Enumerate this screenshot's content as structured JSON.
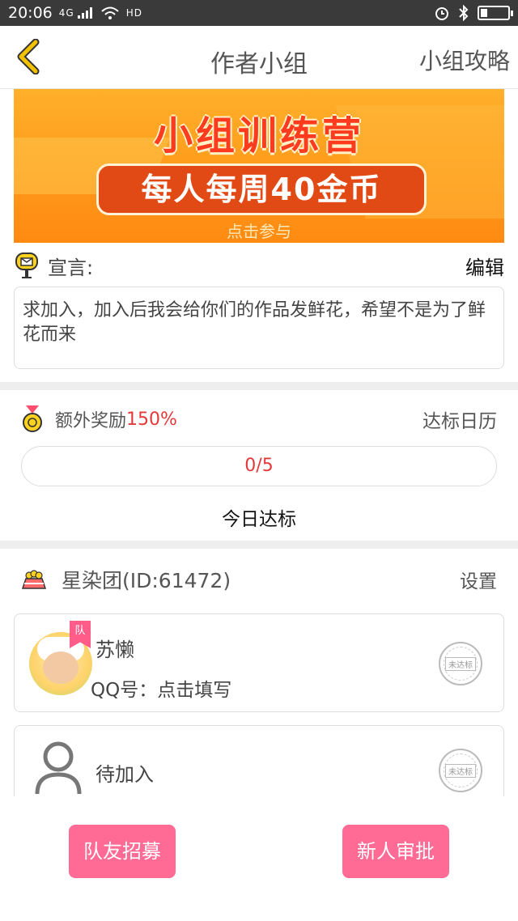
{
  "status_bar": {
    "time": "20:06",
    "signal": "4G",
    "network": "HD"
  },
  "nav": {
    "back_icon": "chevron-left-icon",
    "title": "作者小组",
    "right_link": "小组攻略"
  },
  "banner": {
    "title": "小组训练营",
    "subtitle": "每人每周40金币",
    "cta": "点击参与"
  },
  "manifesto": {
    "label": "宣言:",
    "edit": "编辑",
    "text": "求加入，加入后我会给你们的作品发鲜花，希望不是为了鲜花而来"
  },
  "reward": {
    "label": "额外奖励",
    "percent": "150%",
    "calendar": "达标日历",
    "progress": "0/5",
    "today": "今日达标"
  },
  "group": {
    "name": "星染团(ID:61472)",
    "settings": "设置"
  },
  "members": [
    {
      "leader_badge": "队",
      "name": "苏懒",
      "qq": "QQ号：点击填写",
      "status": "未达标"
    },
    {
      "name": "待加入",
      "status": "未达标"
    }
  ],
  "actions": {
    "recruit": "队友招募",
    "approve": "新人审批"
  },
  "colors": {
    "accent_pink": "#ff6b95",
    "accent_red": "#e5383b",
    "back_yellow": "#f2c200"
  }
}
